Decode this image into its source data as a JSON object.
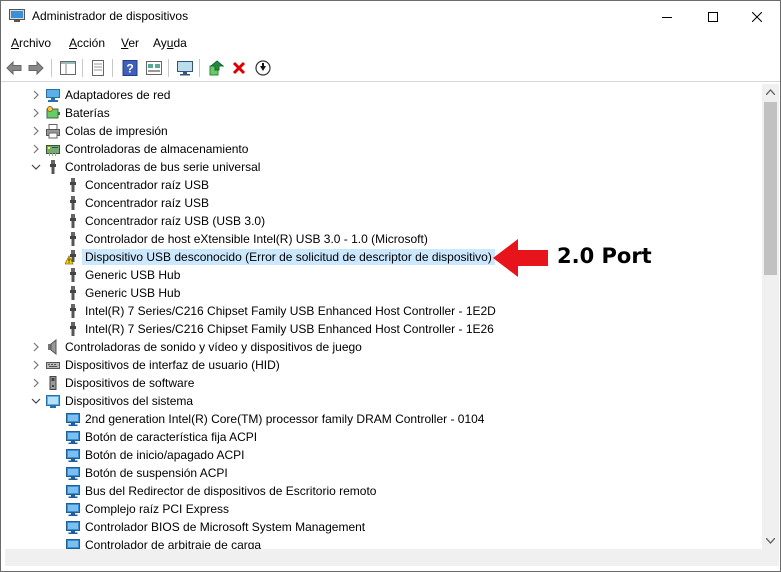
{
  "window": {
    "title": "Administrador de dispositivos"
  },
  "menu": {
    "items": [
      {
        "prefix": "",
        "ul": "A",
        "rest": "rchivo"
      },
      {
        "prefix": "",
        "ul": "A",
        "rest": "cción"
      },
      {
        "prefix": "",
        "ul": "V",
        "rest": "er"
      },
      {
        "prefix": "Ay",
        "ul": "u",
        "rest": "da"
      }
    ]
  },
  "toolbar": {
    "buttons": [
      "back-arrow-icon",
      "forward-arrow-icon",
      "properties-icon",
      "print-icon",
      "help-icon",
      "view-icon",
      "monitor-icon",
      "update-driver-icon",
      "uninstall-icon",
      "disable-icon"
    ]
  },
  "tree": {
    "rows": [
      {
        "label": "Adaptadores de red",
        "level": 0,
        "expanded": false,
        "icon": "network-adapter-icon"
      },
      {
        "label": "Baterías",
        "level": 0,
        "expanded": false,
        "icon": "battery-icon"
      },
      {
        "label": "Colas de impresión",
        "level": 0,
        "expanded": false,
        "icon": "printer-icon"
      },
      {
        "label": "Controladoras de almacenamiento",
        "level": 0,
        "expanded": false,
        "icon": "storage-controller-icon"
      },
      {
        "label": "Controladoras de bus serie universal",
        "level": 0,
        "expanded": true,
        "icon": "usb-icon"
      },
      {
        "label": "Concentrador raíz USB",
        "level": 1,
        "icon": "usb-icon"
      },
      {
        "label": "Concentrador raíz USB",
        "level": 1,
        "icon": "usb-icon"
      },
      {
        "label": "Concentrador raíz USB (USB 3.0)",
        "level": 1,
        "icon": "usb-icon"
      },
      {
        "label": "Controlador de host eXtensible Intel(R) USB 3.0 - 1.0 (Microsoft)",
        "level": 1,
        "icon": "usb-icon"
      },
      {
        "label": "Dispositivo USB desconocido (Error de solicitud de descriptor de dispositivo)",
        "level": 1,
        "icon": "warning-icon",
        "selected": true
      },
      {
        "label": "Generic USB Hub",
        "level": 1,
        "icon": "usb-icon"
      },
      {
        "label": "Generic USB Hub",
        "level": 1,
        "icon": "usb-icon"
      },
      {
        "label": "Intel(R) 7 Series/C216 Chipset Family USB Enhanced Host Controller - 1E2D",
        "level": 1,
        "icon": "usb-icon"
      },
      {
        "label": "Intel(R) 7 Series/C216 Chipset Family USB Enhanced Host Controller - 1E26",
        "level": 1,
        "icon": "usb-icon"
      },
      {
        "label": "Controladoras de sonido y vídeo y dispositivos de juego",
        "level": 0,
        "expanded": false,
        "icon": "speaker-icon"
      },
      {
        "label": "Dispositivos de interfaz de usuario (HID)",
        "level": 0,
        "expanded": false,
        "icon": "hid-icon"
      },
      {
        "label": "Dispositivos de software",
        "level": 0,
        "expanded": false,
        "icon": "software-device-icon"
      },
      {
        "label": "Dispositivos del sistema",
        "level": 0,
        "expanded": true,
        "icon": "system-folder-icon"
      },
      {
        "label": "2nd generation Intel(R) Core(TM) processor family DRAM Controller - 0104",
        "level": 1,
        "icon": "system-device-icon"
      },
      {
        "label": "Botón de característica fija ACPI",
        "level": 1,
        "icon": "system-device-icon"
      },
      {
        "label": "Botón de inicio/apagado ACPI",
        "level": 1,
        "icon": "system-device-icon"
      },
      {
        "label": "Botón de suspensión ACPI",
        "level": 1,
        "icon": "system-device-icon"
      },
      {
        "label": "Bus del Redirector de dispositivos de Escritorio remoto",
        "level": 1,
        "icon": "system-device-icon"
      },
      {
        "label": "Complejo raíz PCI Express",
        "level": 1,
        "icon": "system-device-icon"
      },
      {
        "label": "Controlador BIOS de Microsoft System Management",
        "level": 1,
        "icon": "system-device-icon"
      },
      {
        "label": "Controlador de arbitraje de carga",
        "level": 1,
        "icon": "system-device-icon"
      }
    ]
  },
  "annotation": {
    "text": "2.0 Port",
    "color": "#e8141c"
  }
}
